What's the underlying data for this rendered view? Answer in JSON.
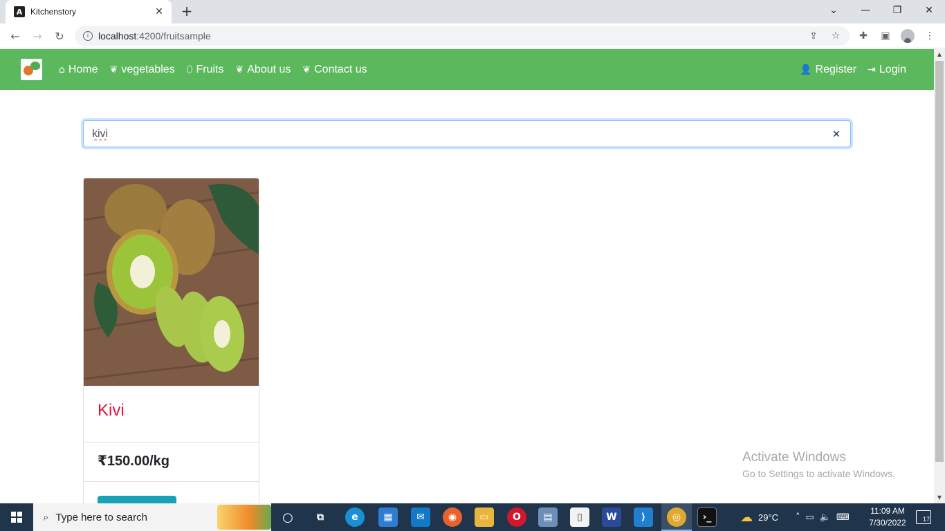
{
  "browser": {
    "tab_title": "Kitchenstory",
    "tab_favicon_letter": "A",
    "url_host": "localhost",
    "url_path": ":4200/fruitsample"
  },
  "nav": {
    "links": [
      {
        "label": "Home",
        "icon": "home-icon"
      },
      {
        "label": "vegetables",
        "icon": "leaf-icon"
      },
      {
        "label": "Fruits",
        "icon": "lemon-icon"
      },
      {
        "label": "About us",
        "icon": "leaf-icon"
      },
      {
        "label": "Contact us",
        "icon": "leaf-icon"
      }
    ],
    "register_label": "Register",
    "login_label": "Login",
    "bar_color": "#5cb85c"
  },
  "search": {
    "value": "kivi"
  },
  "product": {
    "name": "Kivi",
    "price": "₹150.00/kg",
    "title_color": "#dc143c",
    "button_color": "#17a2b8"
  },
  "watermark": {
    "line1": "Activate Windows",
    "line2": "Go to Settings to activate Windows."
  },
  "taskbar": {
    "search_placeholder": "Type here to search",
    "temperature": "29°C",
    "time": "11:09 AM",
    "date": "7/30/2022",
    "notification_count": "17"
  }
}
